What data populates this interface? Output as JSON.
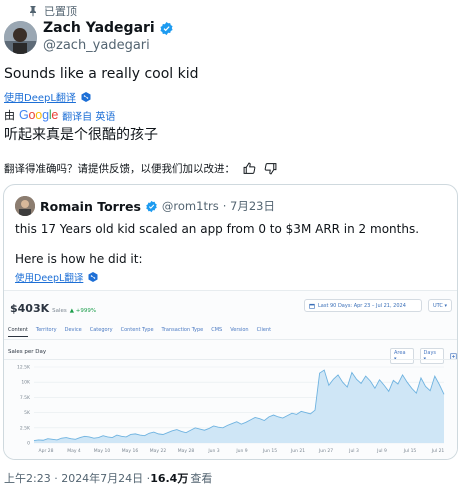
{
  "pinned_label": "已置顶",
  "author": {
    "name": "Zach Yadegari",
    "handle": "@zach_yadegari"
  },
  "tweet_text": "Sounds like a really cool kid",
  "deepl_link": "使用DeepL翻译",
  "translation": {
    "prefix": "由",
    "provider": "Google",
    "from_label": "翻译自 英语",
    "text": "听起来真是个很酷的孩子",
    "feedback_prompt": "翻译得准确吗？请提供反馈，以便我们加以改进："
  },
  "quote": {
    "name": "Romain Torres",
    "handle": "@rom1trs",
    "date": "· 7月23日",
    "line1": "this 17 Years old kid scaled an app from 0 to $3M ARR in 2 months.",
    "line2": "Here is how he did it:",
    "deepl_link": "使用DeepL翻译"
  },
  "dashboard": {
    "revenue_value": "$403K",
    "revenue_label": "Sales",
    "revenue_change": "▲ +999%",
    "date_range": "Last 90 Days: Apr 23 – Jul 21, 2024",
    "currency": "UTC ▾",
    "tabs": [
      "Content",
      "Territory",
      "Device",
      "Category",
      "Content Type",
      "Transaction Type",
      "CMS",
      "Version",
      "Client"
    ],
    "section_title": "Sales per Day",
    "control_area": "Area ▾",
    "control_days": "Days ▾"
  },
  "footer": {
    "time": "上午2:23 · 2024年7月24日 · ",
    "views": "16.4万",
    "views_label": "查看"
  },
  "chart_data": {
    "type": "area",
    "title": "Sales per Day",
    "xlabel": "",
    "ylabel": "",
    "y_ticks": [
      "0",
      "2.5K",
      "5K",
      "7.5K",
      "10K",
      "12.5K"
    ],
    "ylim": [
      0,
      12500
    ],
    "x_ticks": [
      "Apr 28",
      "May 4",
      "May 10",
      "May 16",
      "May 22",
      "May 28",
      "Jun 3",
      "Jun 9",
      "Jun 15",
      "Jun 21",
      "Jun 27",
      "Jul 3",
      "Jul 9",
      "Jul 15",
      "Jul 21"
    ],
    "grid": true,
    "color": "#6fb3e0",
    "series": [
      {
        "values": [
          400,
          500,
          450,
          700,
          600,
          500,
          800,
          900,
          700,
          600,
          900,
          1100,
          1000,
          800,
          900,
          1200,
          1000,
          900,
          1300,
          1100,
          1000,
          1400,
          1500,
          1300,
          1200,
          1600,
          1800,
          1500,
          1400,
          1700,
          2000,
          2200,
          1900,
          1700,
          2100,
          2500,
          2300,
          2100,
          2400,
          2800,
          2600,
          2500,
          2900,
          3200,
          3500,
          3100,
          3400,
          3800,
          4200,
          4000,
          3700,
          4300,
          4600,
          4300,
          4100,
          4500,
          4900,
          4700,
          5200,
          5000,
          4800,
          5400,
          11500,
          12000,
          9500,
          10500,
          11200,
          10000,
          9200,
          11600,
          10500,
          9800,
          11000,
          10200,
          9000,
          10400,
          9500,
          8500,
          10300,
          9700,
          11200,
          10000,
          9000,
          8200,
          10700,
          9300,
          8600,
          11000,
          9600,
          8000
        ]
      }
    ]
  }
}
